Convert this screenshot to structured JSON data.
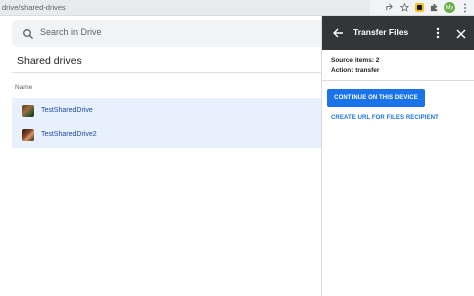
{
  "browser": {
    "url": "drive/shared-drives",
    "avatar_initials": "My"
  },
  "drive": {
    "search_placeholder": "Search in Drive",
    "page_title": "Shared drives",
    "column_name": "Name",
    "items": [
      {
        "label": "TestSharedDrive"
      },
      {
        "label": "TestSharedDrive2"
      }
    ]
  },
  "panel": {
    "title": "Transfer Files",
    "source_items": "Source items: 2",
    "action": "Action: transfer",
    "continue_button": "CONTINUE ON THIS DEVICE",
    "create_url_link": "CREATE URL FOR FILES RECIPIENT"
  },
  "colors": {
    "accent": "#1a73e8",
    "panel_header": "#323639",
    "selection": "#e8f0fe"
  }
}
